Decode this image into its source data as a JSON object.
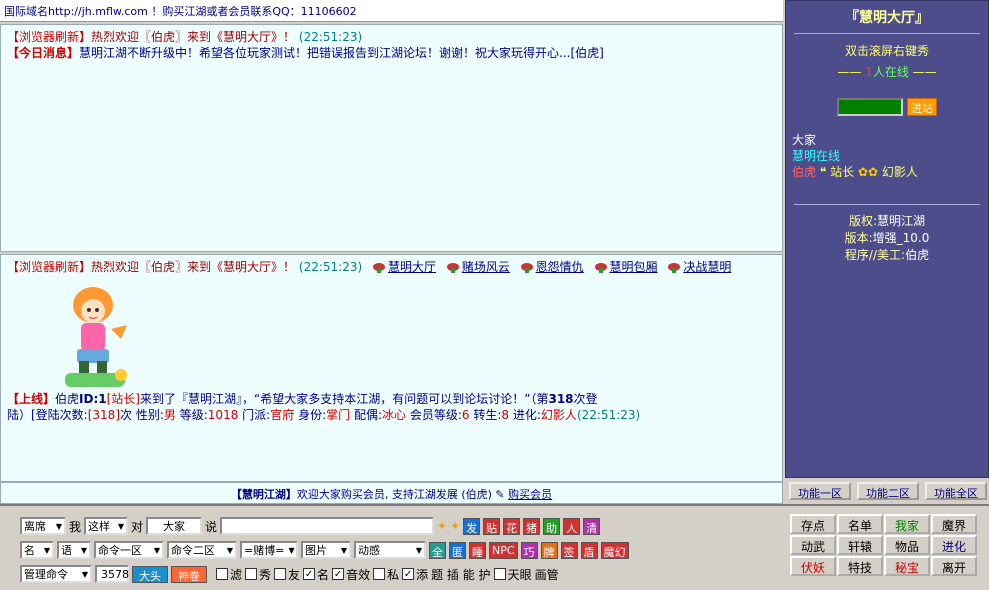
{
  "colors": {
    "sidebar_bg": "#4d4d8c",
    "chat_bg": "#eefefe",
    "system_red": "#cc0000",
    "link_navy": "#000080"
  },
  "topbar": {
    "text": "国际域名http://jh.mflw.com ！购买江湖或者会员联系QQ：11106602"
  },
  "upper_chat": {
    "line1_tag": "【浏览器刷新】",
    "line1_text1": "热烈欢迎",
    "line1_name": "〖伯虎〗",
    "line1_text2": "来到《慧明大厅》！",
    "line1_time": "(22:51:23)",
    "line2_tag": "【今日消息】",
    "line2_text": "慧明江湖不断升级中！希望各位玩家测试！把错误报告到江湖论坛！谢谢！祝大家玩得开心...[伯虎]"
  },
  "lower_chat": {
    "line1_tag": "【浏览器刷新】",
    "line1_text1": "热烈欢迎",
    "line1_name": "〖伯虎〗",
    "line1_text2": "来到《慧明大厅》！",
    "line1_time": "(22:51:23)",
    "rooms": [
      "慧明大厅",
      "赌场风云",
      "恩怨情仇",
      "慧明包厢",
      "决战慧明"
    ],
    "login_tag": "【上线】",
    "login_name": "伯虎",
    "login_id": "ID:1",
    "login_role": "[站长]",
    "login_text1": "来到了",
    "login_place": "『慧明江湖』",
    "login_quote": "，“希望大家多支持本江湖，有问题可以到论坛讨论！”",
    "login_count_pre": "（第",
    "login_count": "318",
    "login_count_post": "次登",
    "detail_pre": "陆）[登陆次数:",
    "detail_count": "[318]",
    "detail_times": "次",
    "detail_sex_label": "性别:",
    "detail_sex": "男",
    "detail_level_label": "等级:",
    "detail_level": "1018",
    "detail_school_label": "门派:",
    "detail_school": "官府",
    "detail_id_label": "身份:",
    "detail_id": "掌门",
    "detail_mate_label": "配偶:",
    "detail_mate": "冰心",
    "detail_vip_label": "会员等级:",
    "detail_vip": "6",
    "detail_reborn_label": "转生:",
    "detail_reborn": "8",
    "detail_evolve_label": "进化:",
    "detail_evolve": "幻影人",
    "detail_time": "(22:51:23)"
  },
  "announce": {
    "tag": "【慧明江湖】",
    "text": "欢迎大家购买会员, 支持江湖发展 (伯虎)",
    "link": "购买会员"
  },
  "sidebar": {
    "title": "『慧明大厅』",
    "hint": "双击滚屏右键秀",
    "count_num": "1",
    "count_text": "人在线",
    "go_label": "进站",
    "user_all": "大家",
    "user_online": "慧明在线",
    "user_list_a": "伯虎",
    "user_list_b": "站长",
    "user_list_c": "幻影人",
    "copyright_label": "版权:",
    "copyright": "慧明江湖",
    "version_label": "版本:",
    "version": "增强_10.0",
    "program_label": "程序//美工:",
    "program": "伯虎"
  },
  "side_tabs": [
    "功能一区",
    "功能二区",
    "功能全区"
  ],
  "controls": {
    "mode": "离席",
    "me_label": "我",
    "action": "这样",
    "to_label": "对",
    "target": "大家",
    "say_label": "说",
    "color_sel": "名",
    "speech_sel": "语",
    "cmd1": "命令一区",
    "cmd2": "命令二区",
    "gamble": "=赌博=",
    "image": "图片",
    "anim": "动感",
    "admin": "管理命令",
    "num_value": "3578",
    "big_small": "大头",
    "magic": "神卷",
    "row1_buttons": [
      {
        "t": "发",
        "c": "#1a6fd0"
      },
      {
        "t": "贴",
        "c": "#cc3333"
      },
      {
        "t": "花",
        "c": "#cc3333"
      },
      {
        "t": "猪",
        "c": "#cc3333"
      },
      {
        "t": "助",
        "c": "#2a9a2a"
      },
      {
        "t": "人",
        "c": "#cc3333"
      },
      {
        "t": "清",
        "c": "#aa33aa"
      }
    ],
    "row2_buttons": [
      {
        "t": "全",
        "c": "#2a9a8a"
      },
      {
        "t": "匿",
        "c": "#1a6fd0"
      },
      {
        "t": "睡",
        "c": "#cc3333"
      },
      {
        "t": "NPC",
        "c": "#cc3333"
      },
      {
        "t": "巧",
        "c": "#aa33aa"
      },
      {
        "t": "牌",
        "c": "#e07020"
      },
      {
        "t": "签",
        "c": "#cc3333"
      },
      {
        "t": "盾",
        "c": "#cc3333"
      },
      {
        "t": "魔幻",
        "c": "#cc3333"
      }
    ],
    "checks": [
      {
        "t": "滤",
        "on": false
      },
      {
        "t": "秀",
        "on": false
      },
      {
        "t": "友",
        "on": false
      },
      {
        "t": "名",
        "on": true
      },
      {
        "t": "音效",
        "on": true
      },
      {
        "t": "私",
        "on": false
      },
      {
        "t": "添",
        "on": true
      },
      {
        "t": "天眼",
        "on": false
      }
    ],
    "check_extra1": "题 插 能 护",
    "check_extra2": "画管"
  },
  "cmdgrid": [
    {
      "t": "存点",
      "c": "#000"
    },
    {
      "t": "名单",
      "c": "#000"
    },
    {
      "t": "我家",
      "c": "#008000"
    },
    {
      "t": "魔界",
      "c": "#000"
    },
    {
      "t": "动武",
      "c": "#000"
    },
    {
      "t": "轩辕",
      "c": "#000"
    },
    {
      "t": "物品",
      "c": "#000"
    },
    {
      "t": "进化",
      "c": "#000080"
    },
    {
      "t": "伏妖",
      "c": "#cc0000"
    },
    {
      "t": "特技",
      "c": "#000"
    },
    {
      "t": "秘宝",
      "c": "#cc0000"
    },
    {
      "t": "离开",
      "c": "#000"
    }
  ]
}
